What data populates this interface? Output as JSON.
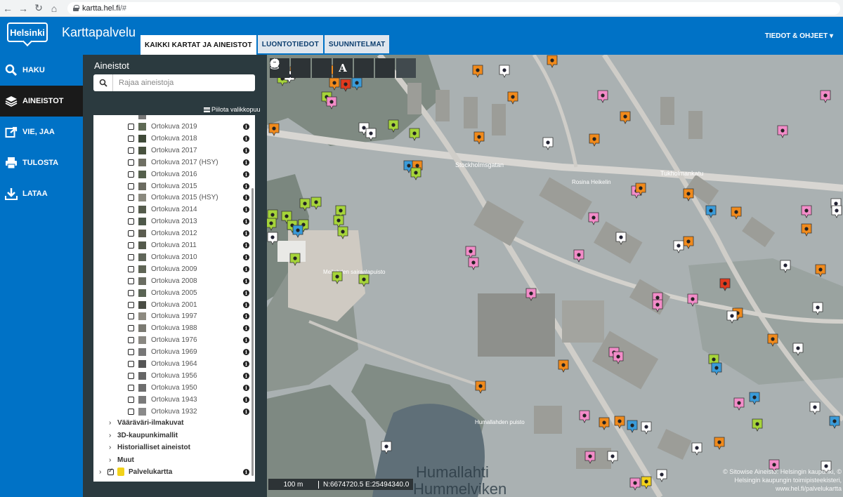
{
  "browser": {
    "url_host": "kartta.hel.fi",
    "url_path": "/#"
  },
  "header": {
    "logo_text": "Helsinki",
    "title": "Karttapalvelu",
    "tabs": [
      {
        "label": "KAIKKI KARTAT JA AINEISTOT",
        "active": true
      },
      {
        "label": "LUONTOTIEDOT",
        "active": false
      },
      {
        "label": "SUUNNITELMAT",
        "active": false
      }
    ],
    "help_menu": "TIEDOT & OHJEET ▾"
  },
  "nav": {
    "items": [
      {
        "label": "HAKU",
        "icon": "search-icon"
      },
      {
        "label": "AINEISTOT",
        "icon": "layers-icon",
        "active": true
      },
      {
        "label": "VIE, JAA",
        "icon": "share-icon"
      },
      {
        "label": "TULOSTA",
        "icon": "print-icon"
      },
      {
        "label": "LATAA",
        "icon": "download-icon"
      }
    ]
  },
  "panel": {
    "title": "Aineistot",
    "search_placeholder": "Rajaa aineistoja",
    "hide_tree_label": "Piilota valikkopuu",
    "layers": [
      "Ortokuva 2019",
      "Ortokuva 2018",
      "Ortokuva 2017",
      "Ortokuva 2017 (HSY)",
      "Ortokuva 2016",
      "Ortokuva 2015",
      "Ortokuva 2015 (HSY)",
      "Ortokuva 2014",
      "Ortokuva 2013",
      "Ortokuva 2012",
      "Ortokuva 2011",
      "Ortokuva 2010",
      "Ortokuva 2009",
      "Ortokuva 2008",
      "Ortokuva 2005",
      "Ortokuva 2001",
      "Ortokuva 1997",
      "Ortokuva 1988",
      "Ortokuva 1976",
      "Ortokuva 1969",
      "Ortokuva 1964",
      "Ortokuva 1956",
      "Ortokuva 1950",
      "Ortokuva 1943",
      "Ortokuva 1932"
    ],
    "groups": [
      "Vääräväri-ilmakuvat",
      "3D-kaupunkimallit",
      "Historialliset aineistot",
      "Muut"
    ],
    "service_map": "Palvelukartta"
  },
  "map": {
    "tools": [
      "home-icon",
      "contrast-icon",
      "measure-icon",
      "text-icon",
      "pan-icon",
      "marker-icon",
      "streetview-icon"
    ],
    "scale": "100 m",
    "coords": "N:6674720.5 E:25494340.0",
    "copyright": "© Sitowise Aineisto: Helsingin kaupunki, © Helsingin kaupungin toimipisteekisteri, www.hel.fi/palvelukartta",
    "water_label_1": "Humallahti",
    "water_label_2": "Hummelviken",
    "street_labels": [
      "Stockholmsgatan",
      "Tukholmankatu",
      "Rosina Heikelin",
      "Meilahden sairaalapuisto",
      "Humallahden puisto"
    ]
  },
  "colors": {
    "brand": "#0072c6",
    "panel": "#2b3a3f",
    "poi_green": "#a6d43a",
    "poi_pink": "#f28cc8",
    "poi_orange": "#f08a1c",
    "poi_blue": "#3a9bd9",
    "poi_white": "#ffffff",
    "poi_red": "#e03a1e"
  }
}
